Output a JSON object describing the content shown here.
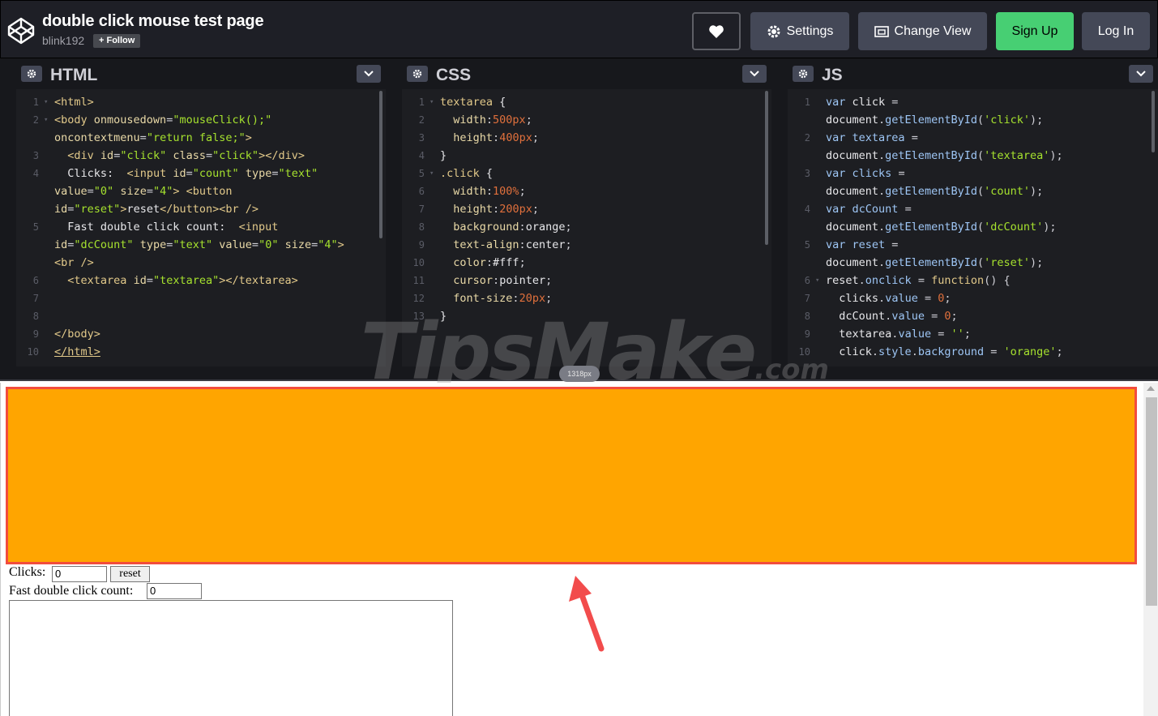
{
  "header": {
    "title": "double click mouse test page",
    "author": "blink192",
    "follow_label": "+ Follow",
    "buttons": {
      "settings": "Settings",
      "change_view": "Change View",
      "sign_up": "Sign Up",
      "log_in": "Log In"
    }
  },
  "panes": {
    "html": {
      "title": "HTML"
    },
    "css": {
      "title": "CSS"
    },
    "js": {
      "title": "JS"
    }
  },
  "watermark": {
    "main": "TipsMake",
    "suffix": ".com"
  },
  "resize_pill": "1318px",
  "preview": {
    "clicks_label": "Clicks:",
    "clicks_value": "0",
    "reset_label": "reset",
    "dc_label": "Fast double click count:",
    "dc_value": "0"
  },
  "colors": {
    "click_box": "#ffa500",
    "highlight_border": "#f24c3d",
    "sign_up": "#47cf73"
  }
}
